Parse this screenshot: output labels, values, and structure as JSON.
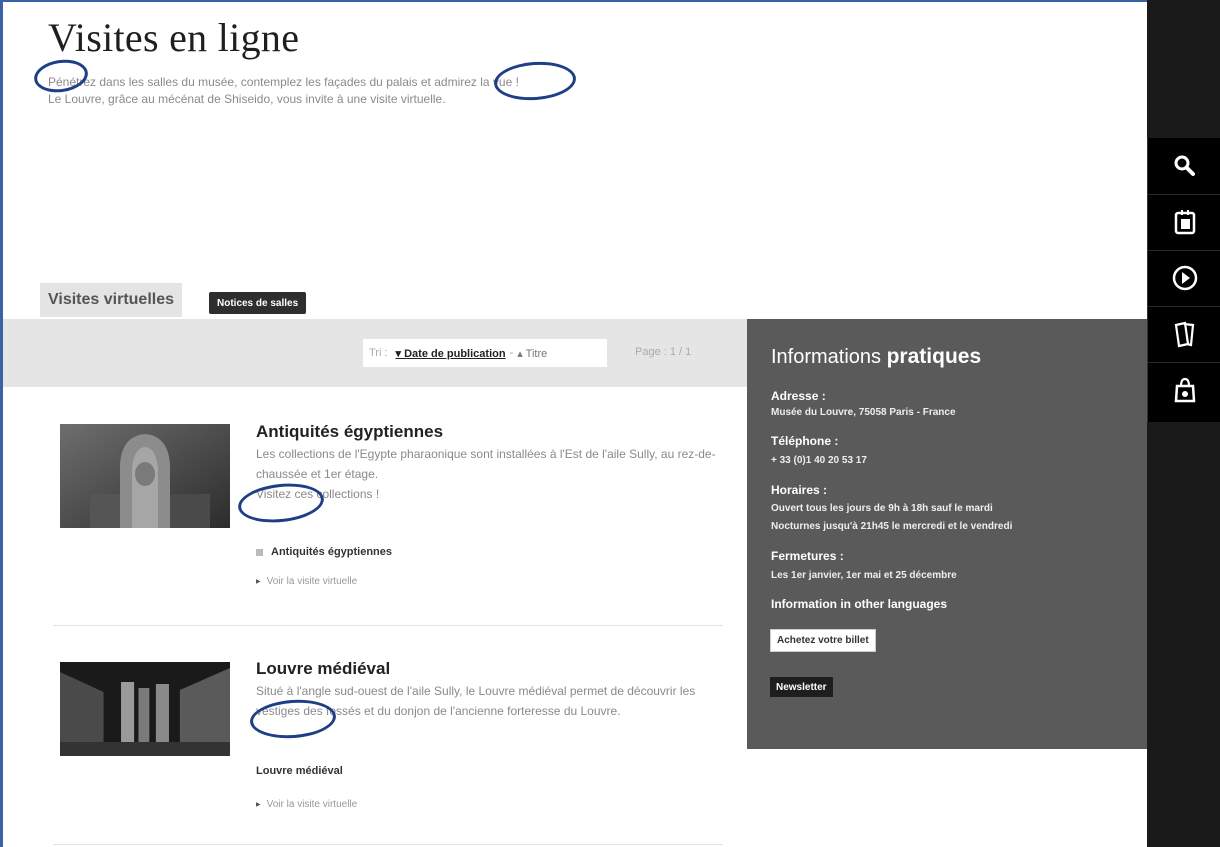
{
  "page": {
    "title": "Visites en ligne",
    "intro_line1_start": "Pénétrez dans les salles du musée, contemplez les façades du palais et ",
    "intro_link": "admirez la vue",
    "intro_line1_end": " !",
    "intro_line2": "Le Louvre, grâce au mécénat de Shiseido, vous invite à une visite virtuelle."
  },
  "tabs": {
    "virtual": "Visites virtuelles",
    "notices": "Notices de salles"
  },
  "sort": {
    "label": "Tri :",
    "active": "▾ Date de publication",
    "sep": "-",
    "other": "▴ Titre",
    "page": "Page : 1 / 1"
  },
  "items": [
    {
      "title": "Antiquités égyptiennes",
      "desc": "Les collections de l'Egypte pharaonique sont installées à l'Est de l'aile Sully, au rez-de-chaussée et 1er étage.",
      "link": "Visitez ces collections !",
      "tag": "Antiquités égyptiennes",
      "visit": "Voir la visite virtuelle"
    },
    {
      "title": "Louvre médiéval",
      "desc": "Situé à l'angle sud-ouest de l'aile Sully, le Louvre médiéval permet de découvrir les vestiges des fossés et du donjon de l'ancienne forteresse du Louvre.",
      "tag": "Louvre médiéval",
      "visit": "Voir la visite virtuelle"
    }
  ],
  "info": {
    "title_light": "Informations ",
    "title_bold": "pratiques",
    "address_h": "Adresse :",
    "address_v": "Musée du Louvre, 75058 Paris - France",
    "phone_h": "Téléphone :",
    "phone_v": "+ 33 (0)1 40 20 53 17",
    "hours_h": "Horaires :",
    "hours_v1": "Ouvert tous les jours de 9h à 18h sauf le mardi",
    "hours_v2": "Nocturnes jusqu'à 21h45 le mercredi et le vendredi",
    "closed_h": "Fermetures :",
    "closed_v": "Les 1er janvier, 1er mai et 25 décembre",
    "lang_h": "Information in other languages",
    "ticket": "Achetez votre billet",
    "newsletter": "Newsletter"
  },
  "side_menu": [
    "search-icon",
    "calendar-icon",
    "play-icon",
    "tickets-icon",
    "shopping-bag-icon"
  ],
  "colors": {
    "info_panel": "#5a5a5a",
    "annotation": "#1e3f86",
    "frame": "#3a62a8"
  }
}
